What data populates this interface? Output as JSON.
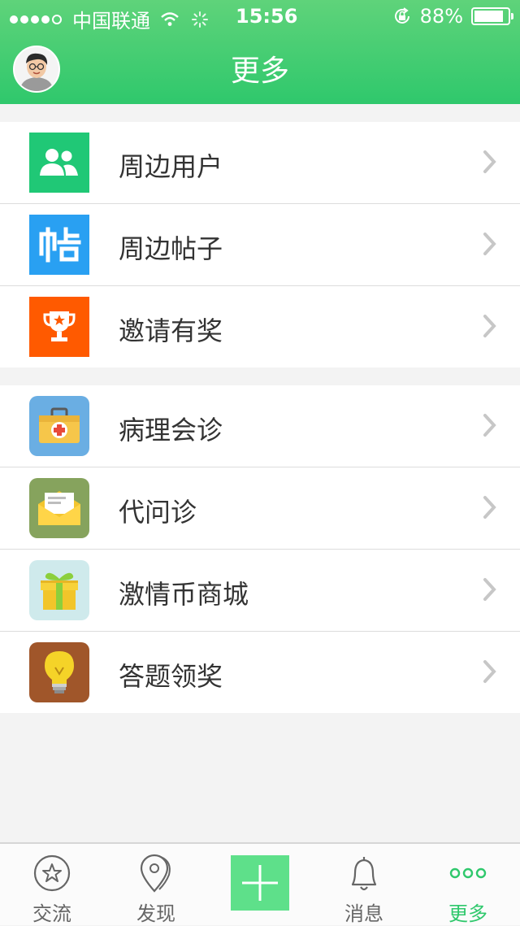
{
  "status_bar": {
    "carrier": "中国联通",
    "time": "15:56",
    "battery_pct": "88%",
    "battery_level": 0.88
  },
  "header": {
    "title": "更多",
    "avatar_icon": "user-avatar"
  },
  "colors": {
    "accent": "#2fc86c",
    "header_top": "#5fd37a",
    "plus_button": "#5ee08a"
  },
  "groups": [
    {
      "items": [
        {
          "label": "周边用户",
          "icon": "users-icon",
          "icon_bg": "#20c876"
        },
        {
          "label": "周边帖子",
          "icon": "post-icon",
          "icon_bg": "#29a0f2"
        },
        {
          "label": "邀请有奖",
          "icon": "trophy-icon",
          "icon_bg": "#ff5a00"
        }
      ]
    },
    {
      "items": [
        {
          "label": "病理会诊",
          "icon": "medical-kit-icon",
          "icon_bg": "#6aaee3"
        },
        {
          "label": "代问诊",
          "icon": "envelope-icon",
          "icon_bg": "#86a35d"
        },
        {
          "label": "激情币商城",
          "icon": "gift-icon",
          "icon_bg": "#cfeaec"
        },
        {
          "label": "答题领奖",
          "icon": "lightbulb-icon",
          "icon_bg": "#a0562a"
        }
      ]
    }
  ],
  "tabs": [
    {
      "label": "交流",
      "icon": "star-circle-icon"
    },
    {
      "label": "发现",
      "icon": "location-pin-icon"
    },
    {
      "label": "",
      "icon": "plus-icon"
    },
    {
      "label": "消息",
      "icon": "bell-icon"
    },
    {
      "label": "更多",
      "icon": "more-dots-icon",
      "active": true
    }
  ]
}
